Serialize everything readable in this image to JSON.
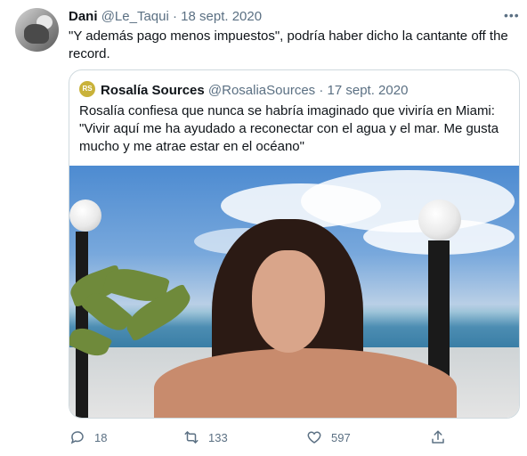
{
  "tweet": {
    "author_name": "Dani",
    "author_handle": "@Le_Taqui",
    "separator": "·",
    "date": "18 sept. 2020",
    "more_label": "•••",
    "text": "\"Y además pago menos impuestos\", podría haber dicho la cantante off the record."
  },
  "quoted": {
    "avatar_initials": "RS",
    "author_name": "Rosalía Sources",
    "author_handle": "@RosaliaSources",
    "separator": "·",
    "date": "17 sept. 2020",
    "text": "Rosalía confiesa que nunca se habría imaginado que viviría en Miami: \"Vivir aquí me ha ayudado a reconectar con el agua y el mar. Me gusta mucho y me atrae estar en el océano\""
  },
  "actions": {
    "reply_count": "18",
    "retweet_count": "133",
    "like_count": "597"
  },
  "icons": {
    "reply": "reply-icon",
    "retweet": "retweet-icon",
    "like": "heart-icon",
    "share": "share-icon"
  },
  "colors": {
    "muted": "#5b7083",
    "border": "#cfd9de",
    "text": "#0f1419"
  }
}
